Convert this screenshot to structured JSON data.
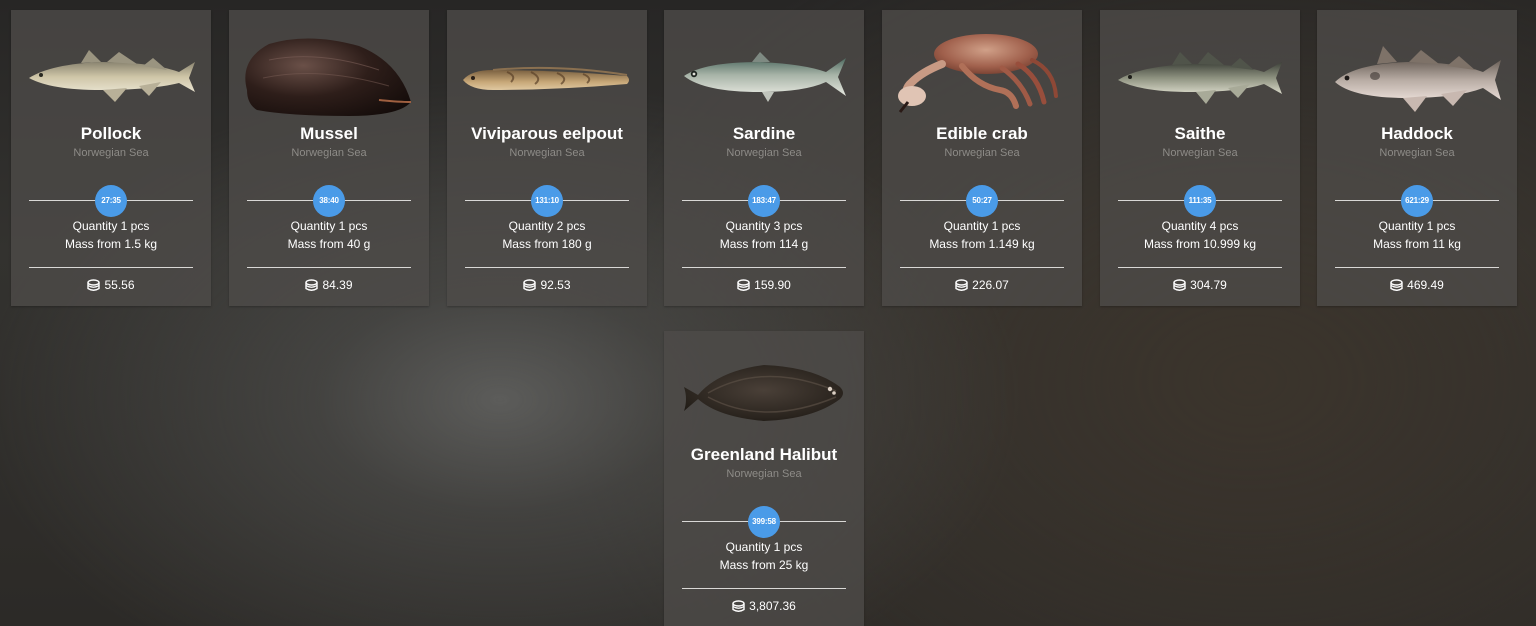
{
  "cards": [
    {
      "name": "Pollock",
      "region": "Norwegian Sea",
      "timer": "27:35",
      "quantity": "Quantity 1 pcs",
      "mass": "Mass from 1.5 kg",
      "price": "55.56",
      "icon": "pollock-image"
    },
    {
      "name": "Mussel",
      "region": "Norwegian Sea",
      "timer": "38:40",
      "quantity": "Quantity 1 pcs",
      "mass": "Mass from 40 g",
      "price": "84.39",
      "icon": "mussel-image"
    },
    {
      "name": "Viviparous eelpout",
      "region": "Norwegian Sea",
      "timer": "131:10",
      "quantity": "Quantity 2 pcs",
      "mass": "Mass from 180 g",
      "price": "92.53",
      "icon": "eelpout-image"
    },
    {
      "name": "Sardine",
      "region": "Norwegian Sea",
      "timer": "183:47",
      "quantity": "Quantity 3 pcs",
      "mass": "Mass from 114 g",
      "price": "159.90",
      "icon": "sardine-image"
    },
    {
      "name": "Edible crab",
      "region": "Norwegian Sea",
      "timer": "50:27",
      "quantity": "Quantity 1 pcs",
      "mass": "Mass from 1.149 kg",
      "price": "226.07",
      "icon": "crab-image"
    },
    {
      "name": "Saithe",
      "region": "Norwegian Sea",
      "timer": "111:35",
      "quantity": "Quantity 4 pcs",
      "mass": "Mass from 10.999 kg",
      "price": "304.79",
      "icon": "saithe-image"
    },
    {
      "name": "Haddock",
      "region": "Norwegian Sea",
      "timer": "621:29",
      "quantity": "Quantity 1 pcs",
      "mass": "Mass from 11 kg",
      "price": "469.49",
      "icon": "haddock-image"
    },
    {
      "name": "Greenland Halibut",
      "region": "Norwegian Sea",
      "timer": "399:58",
      "quantity": "Quantity 1 pcs",
      "mass": "Mass from 25 kg",
      "price": "3,807.36",
      "icon": "halibut-image"
    }
  ],
  "colors": {
    "timer_badge": "#4a9be8",
    "card_background": "#4e4c49",
    "region_text": "#8d8b87"
  },
  "price_icon": "coins-icon"
}
